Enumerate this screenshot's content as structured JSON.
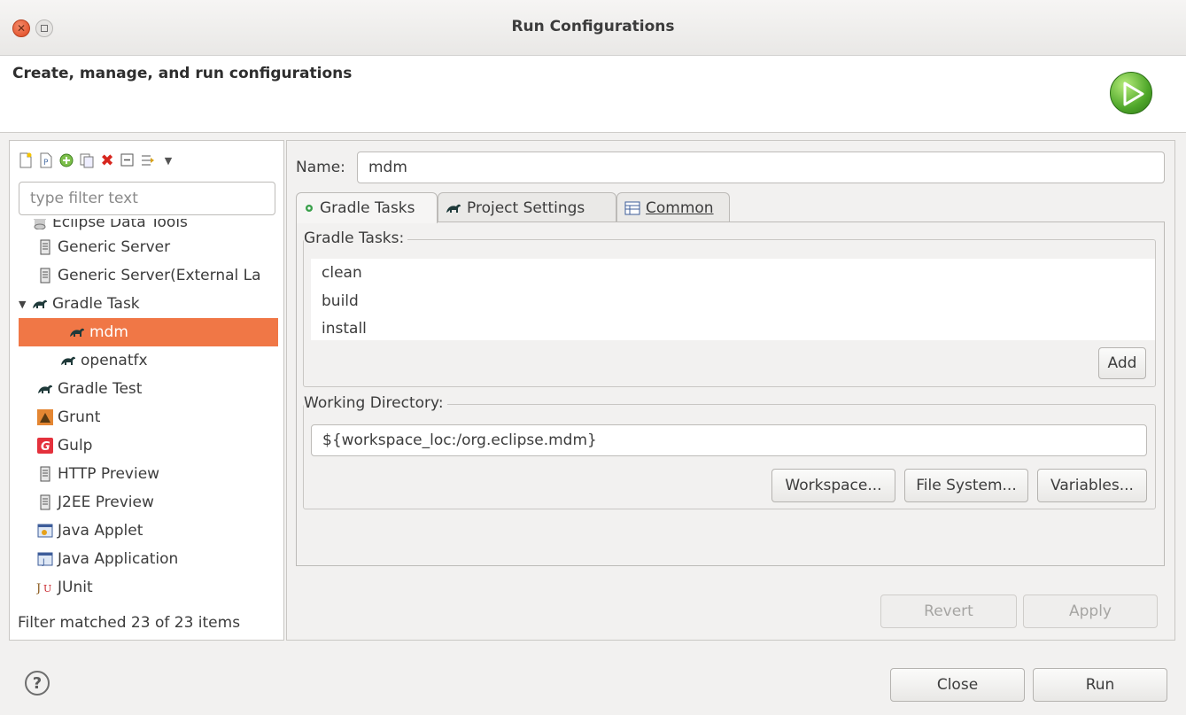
{
  "window": {
    "title": "Run Configurations"
  },
  "header": {
    "heading": "Create, manage, and run configurations"
  },
  "sidebar": {
    "filter_placeholder": "type filter text",
    "items": [
      {
        "label": "Eclipse Data Tools",
        "icon": "database-icon",
        "level": 1
      },
      {
        "label": "Generic Server",
        "icon": "server-icon",
        "level": 1
      },
      {
        "label": "Generic Server(External La",
        "icon": "server-icon",
        "level": 1
      },
      {
        "label": "Gradle Task",
        "icon": "gradle-icon",
        "level": 0,
        "expanded": true
      },
      {
        "label": "mdm",
        "icon": "gradle-icon",
        "level": 2,
        "selected": true
      },
      {
        "label": "openatfx",
        "icon": "gradle-icon",
        "level": 2
      },
      {
        "label": "Gradle Test",
        "icon": "gradle-icon",
        "level": 1
      },
      {
        "label": "Grunt",
        "icon": "grunt-icon",
        "level": 1
      },
      {
        "label": "Gulp",
        "icon": "gulp-icon",
        "level": 1
      },
      {
        "label": "HTTP Preview",
        "icon": "server-icon",
        "level": 1
      },
      {
        "label": "J2EE Preview",
        "icon": "server-icon",
        "level": 1
      },
      {
        "label": "Java Applet",
        "icon": "applet-icon",
        "level": 1
      },
      {
        "label": "Java Application",
        "icon": "java-app-icon",
        "level": 1
      },
      {
        "label": "JUnit",
        "icon": "junit-icon",
        "level": 1
      }
    ],
    "status": "Filter matched 23 of 23 items"
  },
  "config": {
    "name_label": "Name:",
    "name_value": "mdm",
    "tabs": [
      {
        "label": "Gradle Tasks",
        "icon": "gear-icon",
        "active": true
      },
      {
        "label": "Project Settings",
        "icon": "gradle-icon"
      },
      {
        "label": "Common",
        "icon": "table-icon"
      }
    ],
    "gradle_tasks_label": "Gradle Tasks:",
    "tasks": [
      "clean",
      "build",
      "install"
    ],
    "add_label": "Add",
    "working_dir_label": "Working Directory:",
    "working_dir_value": "${workspace_loc:/org.eclipse.mdm}",
    "workspace_label": "Workspace...",
    "filesystem_label": "File System...",
    "variables_label": "Variables...",
    "revert_label": "Revert",
    "apply_label": "Apply"
  },
  "footer": {
    "close_label": "Close",
    "run_label": "Run"
  },
  "colors": {
    "selection": "#f07746",
    "accent_green": "#4fa72a"
  }
}
